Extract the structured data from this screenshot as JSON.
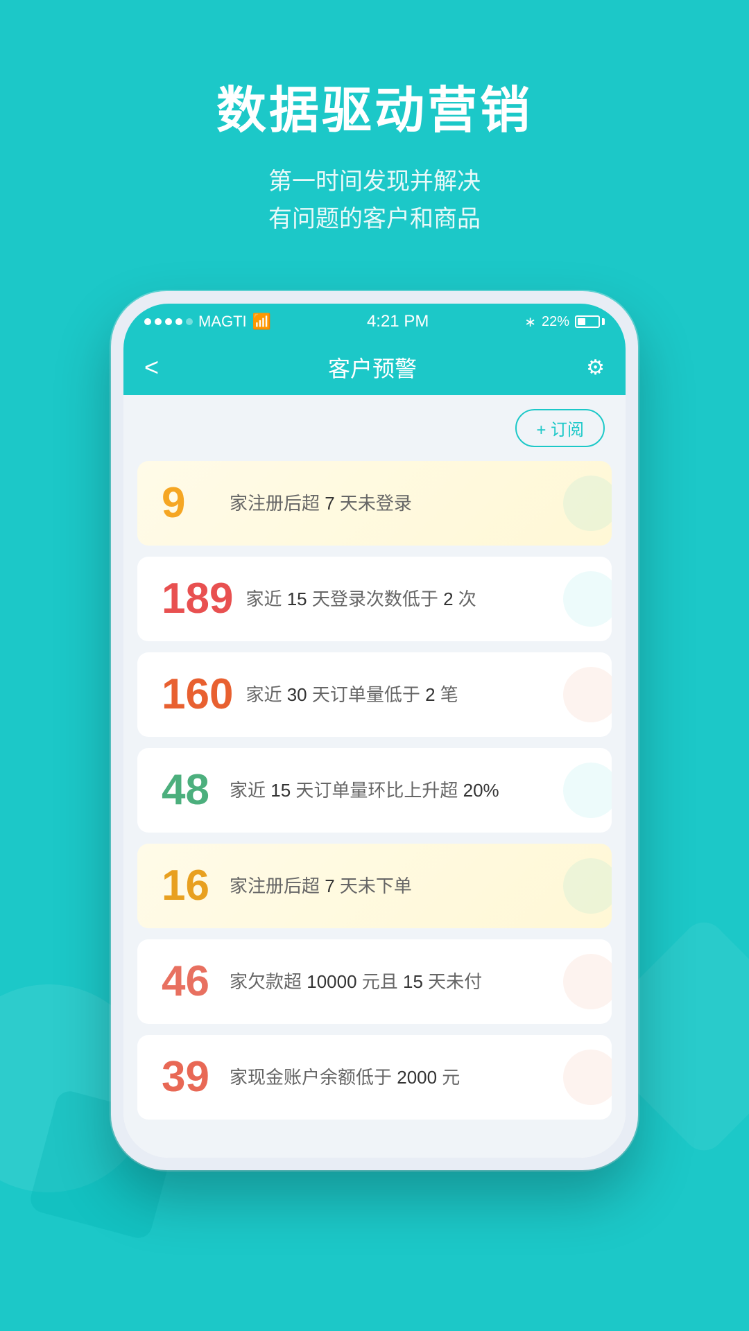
{
  "background_color": "#1cc8c8",
  "header": {
    "title": "数据驱动营销",
    "subtitle_line1": "第一时间发现并解决",
    "subtitle_line2": "有问题的客户和商品"
  },
  "status_bar": {
    "carrier": "MAGTI",
    "wifi": true,
    "time": "4:21 PM",
    "bluetooth": true,
    "battery_pct": "22%"
  },
  "nav": {
    "back_label": "<",
    "title": "客户预警",
    "settings_label": "⚙"
  },
  "subscribe_btn_label": "+ 订阅",
  "alerts": [
    {
      "number": "9",
      "color": "yellow",
      "text": "家注册后超 7 天未登录",
      "bg": "yellow"
    },
    {
      "number": "189",
      "color": "red",
      "text": "家近 15 天登录次数低于 2 次",
      "bg": "white"
    },
    {
      "number": "160",
      "color": "orange",
      "text": "家近 30 天订单量低于 2 笔",
      "bg": "white"
    },
    {
      "number": "48",
      "color": "green",
      "text": "家近 15 天订单量环比上升超 20%",
      "bg": "white"
    },
    {
      "number": "16",
      "color": "gold",
      "text": "家注册后超 7 天未下单",
      "bg": "yellow"
    },
    {
      "number": "46",
      "color": "salmon",
      "text": "家欠款超 10000 元且 15 天未付",
      "bg": "white"
    },
    {
      "number": "39",
      "color": "coral",
      "text": "家现金账户余额低于 2000 元",
      "bg": "white"
    }
  ]
}
